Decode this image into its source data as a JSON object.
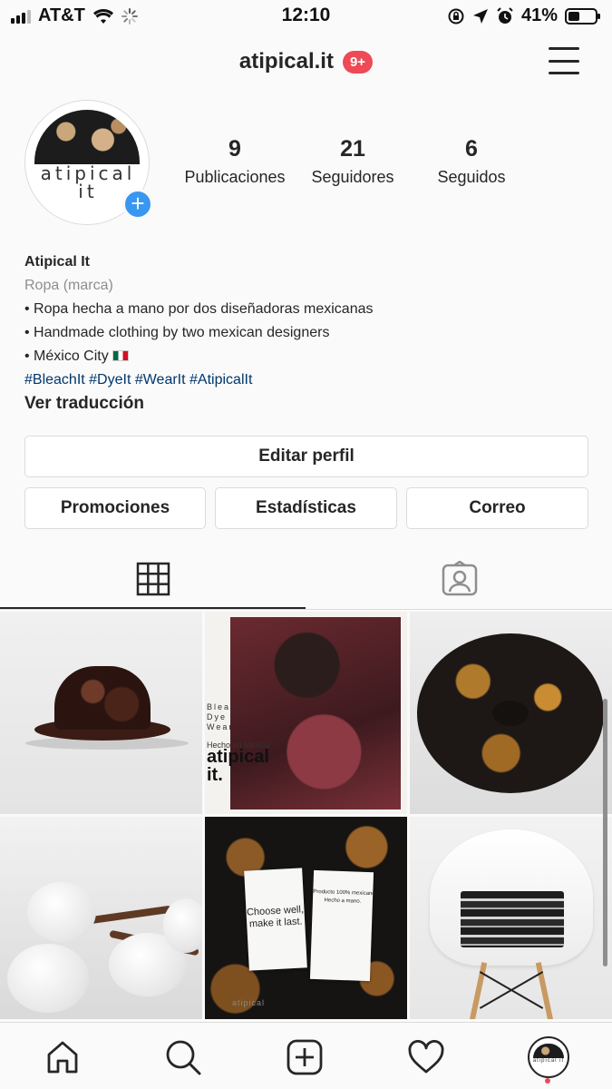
{
  "status_bar": {
    "carrier": "AT&T",
    "time": "12:10",
    "battery": "41%"
  },
  "header": {
    "username": "atipical.it",
    "notification_badge": "9+",
    "icons": {
      "menu": "hamburger-menu-icon"
    }
  },
  "profile": {
    "avatar_text_line1": "atipical",
    "avatar_text_line2": "it",
    "add_story_symbol": "+",
    "stats": [
      {
        "value": "9",
        "label": "Publicaciones"
      },
      {
        "value": "21",
        "label": "Seguidores"
      },
      {
        "value": "6",
        "label": "Seguidos"
      }
    ],
    "name": "Atipical It",
    "category": "Ropa (marca)",
    "bio_lines": [
      "• Ropa hecha a mano por dos diseñadoras mexicanas",
      "• Handmade clothing by two mexican designers",
      "• México City"
    ],
    "hashtags": "#BleachIt #DyeIt #WearIt #AtipicalIt",
    "translate_link": "Ver traducción"
  },
  "actions": {
    "edit_profile": "Editar perfil",
    "promotions": "Promociones",
    "insights": "Estadísticas",
    "email": "Correo"
  },
  "tabs": [
    {
      "icon": "grid-icon",
      "active": true
    },
    {
      "icon": "tagged-person-icon",
      "active": false
    }
  ],
  "posts": {
    "post2_small_text": "Bleach\nDye\nWear",
    "post2_caption_small": "Hecho en México",
    "post2_caption": "atipical\nit.",
    "post5_label1": "Choose well,\nmake it last.",
    "post5_label2": "Producto 100% mexicano.\nHecho a mano.",
    "post5_footer": "atipical"
  },
  "bottom_nav": {
    "items": [
      "home-icon",
      "search-icon",
      "new-post-icon",
      "activity-heart-icon",
      "profile-avatar-icon"
    ],
    "avatar_text": "atipical it"
  },
  "colors": {
    "accent_blue": "#3897f0",
    "badge_red": "#ed4956",
    "hashtag_blue": "#00376b"
  }
}
